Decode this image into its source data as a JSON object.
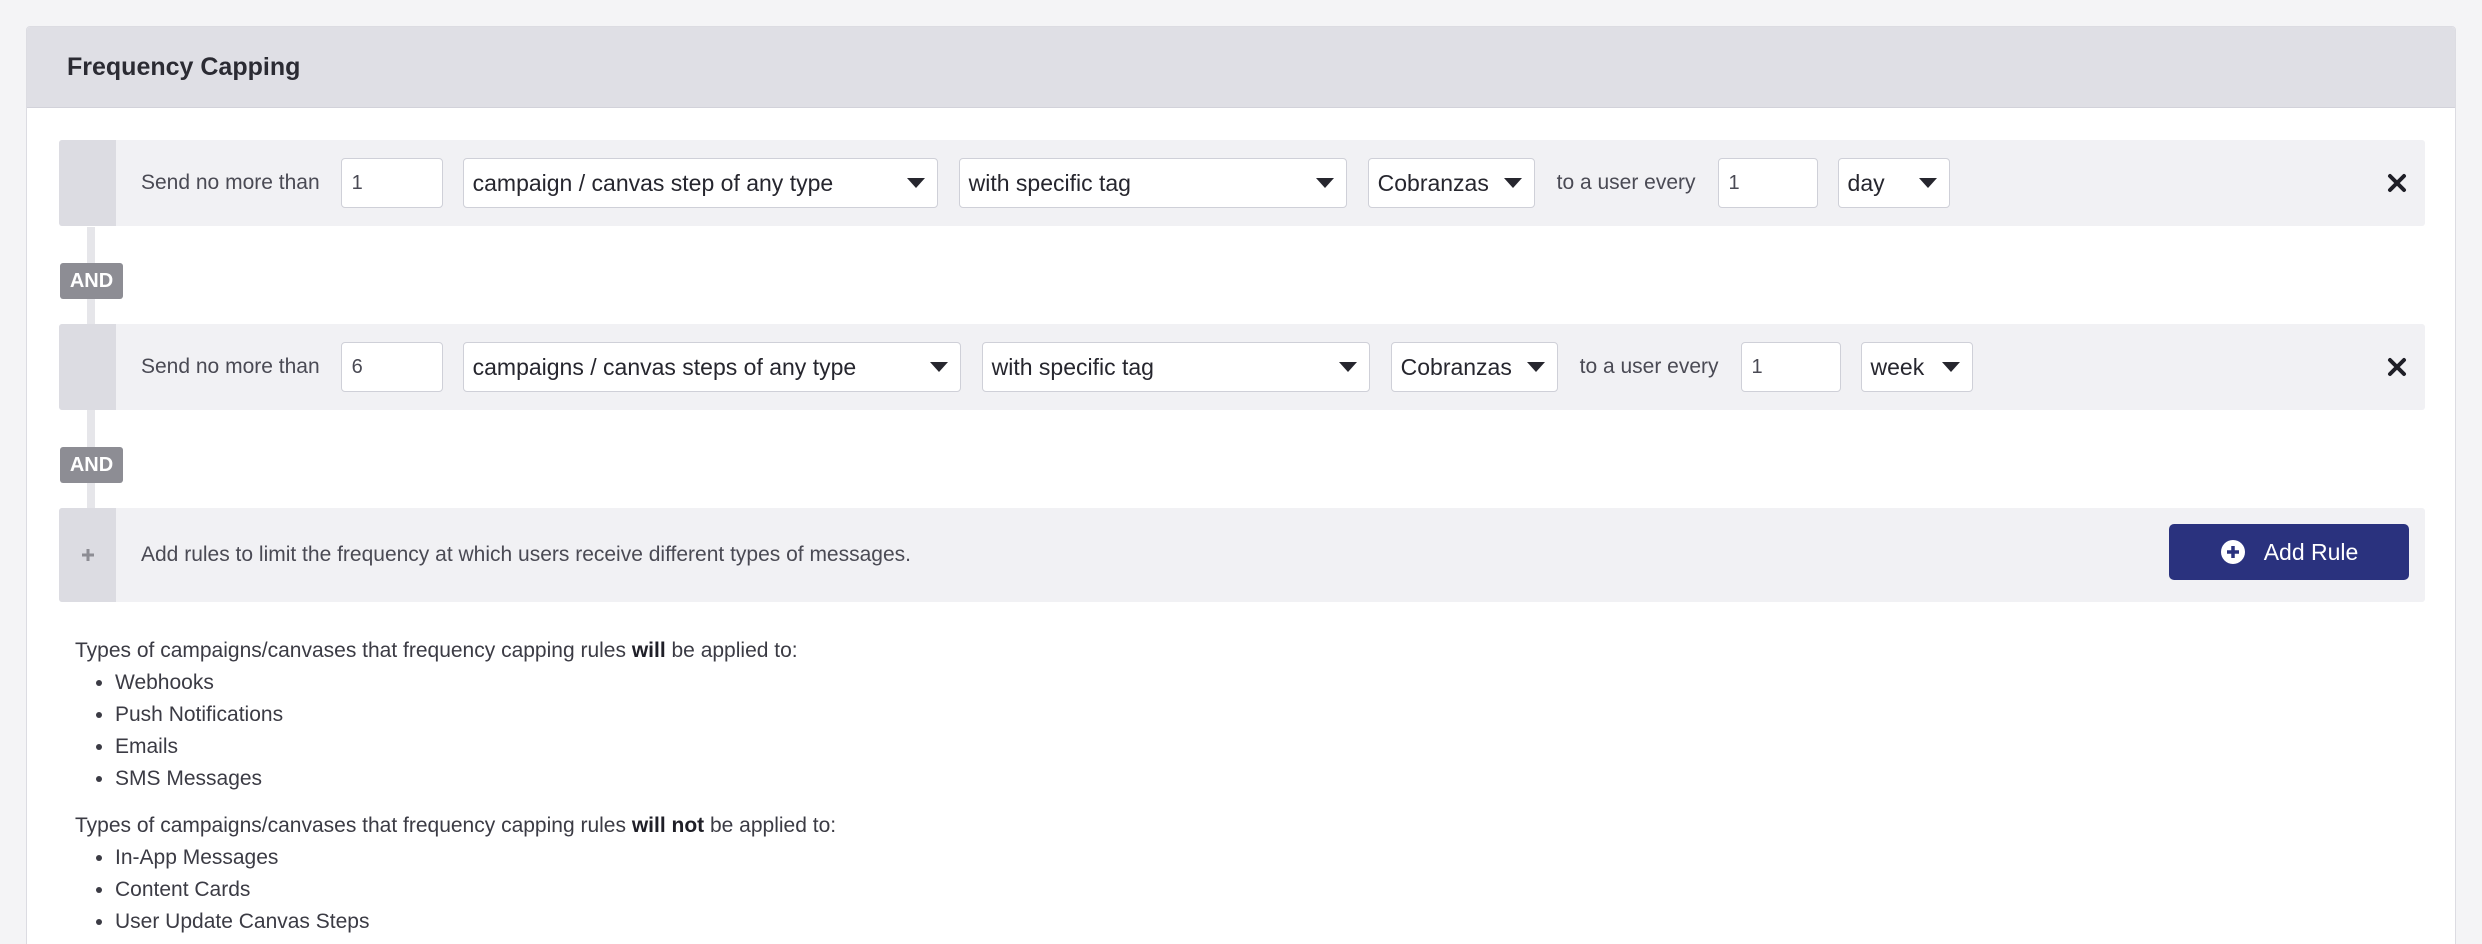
{
  "panel": {
    "title": "Frequency Capping"
  },
  "rules": [
    {
      "prefix": "Send no more than",
      "count": "1",
      "message_type": "campaign / canvas step of any type",
      "filter": "with specific tag",
      "tag": "Cobranzas",
      "middle": "to a user every",
      "period_count": "1",
      "period_unit": "day"
    },
    {
      "prefix": "Send no more than",
      "count": "6",
      "message_type": "campaigns / canvas steps of any type",
      "filter": "with specific tag",
      "tag": "Cobranzas",
      "middle": "to a user every",
      "period_count": "1",
      "period_unit": "week"
    }
  ],
  "and_label": "AND",
  "add_row": {
    "hint": "Add rules to limit the frequency at which users receive different types of messages.",
    "button_label": "Add Rule"
  },
  "applied": {
    "intro_before": "Types of campaigns/canvases that frequency capping rules ",
    "intro_emph": "will",
    "intro_after": " be applied to:",
    "items": [
      "Webhooks",
      "Push Notifications",
      "Emails",
      "SMS Messages"
    ]
  },
  "not_applied": {
    "intro_before": "Types of campaigns/canvases that frequency capping rules ",
    "intro_emph": "will not",
    "intro_after": " be applied to:",
    "items": [
      "In-App Messages",
      "Content Cards",
      "User Update Canvas Steps"
    ]
  },
  "colors": {
    "accent": "#2a327e",
    "badge": "#8d8d94",
    "header_bg": "#dfdfe5"
  }
}
